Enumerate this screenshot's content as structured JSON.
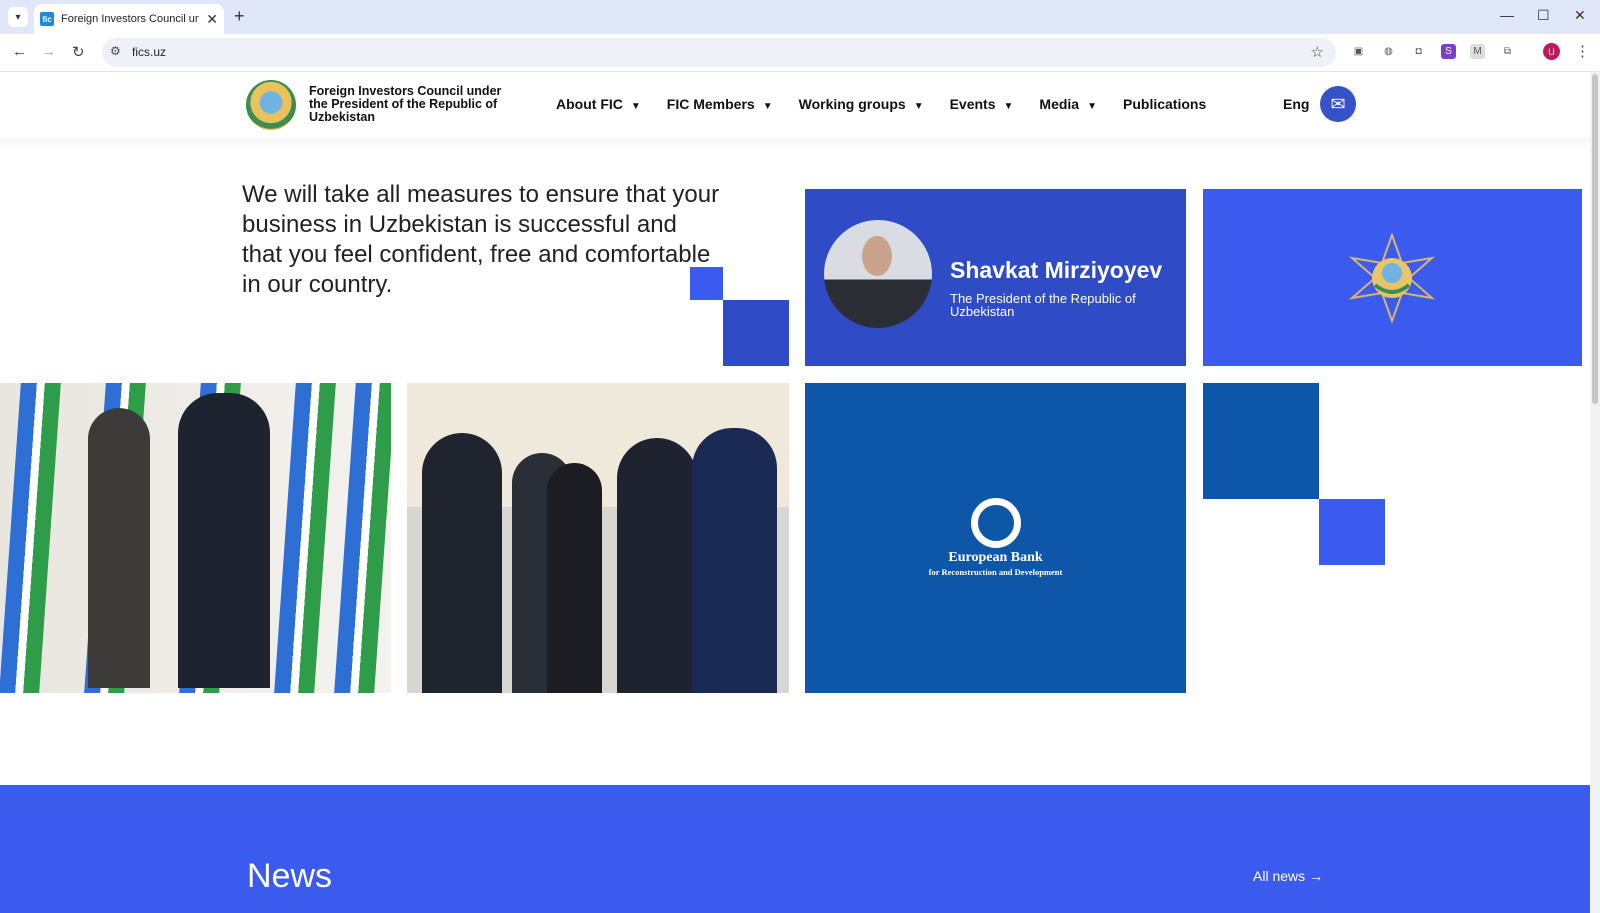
{
  "browser": {
    "tab_title": "Foreign Investors Council unde",
    "url": "fics.uz",
    "favicon_text": "fic",
    "new_tab": "+",
    "profile_initial": "U"
  },
  "header": {
    "org_name": "Foreign Investors Council under the President of the Republic of Uzbekistan",
    "nav": [
      {
        "label": "About FIC",
        "dropdown": true
      },
      {
        "label": "FIC Members",
        "dropdown": true
      },
      {
        "label": "Working groups",
        "dropdown": true
      },
      {
        "label": "Events",
        "dropdown": true
      },
      {
        "label": "Media",
        "dropdown": true
      },
      {
        "label": "Publications",
        "dropdown": false
      }
    ],
    "language": "Eng"
  },
  "hero": {
    "quote": "We will take all measures to ensure that your business in Uzbekistan is successful and that you feel confident, free and comfortable in our country.",
    "president_name": "Shavkat Mirziyoyev",
    "president_title": "The President of the Republic of Uzbekistan"
  },
  "partner": {
    "name": "European Bank",
    "subtitle": "for Reconstruction and Development"
  },
  "news": {
    "heading": "News",
    "all_news": "All news →"
  },
  "colors": {
    "accent_blue": "#3b5bef",
    "dark_blue": "#2f4bc5",
    "ebrd_blue": "#0d56a8"
  }
}
